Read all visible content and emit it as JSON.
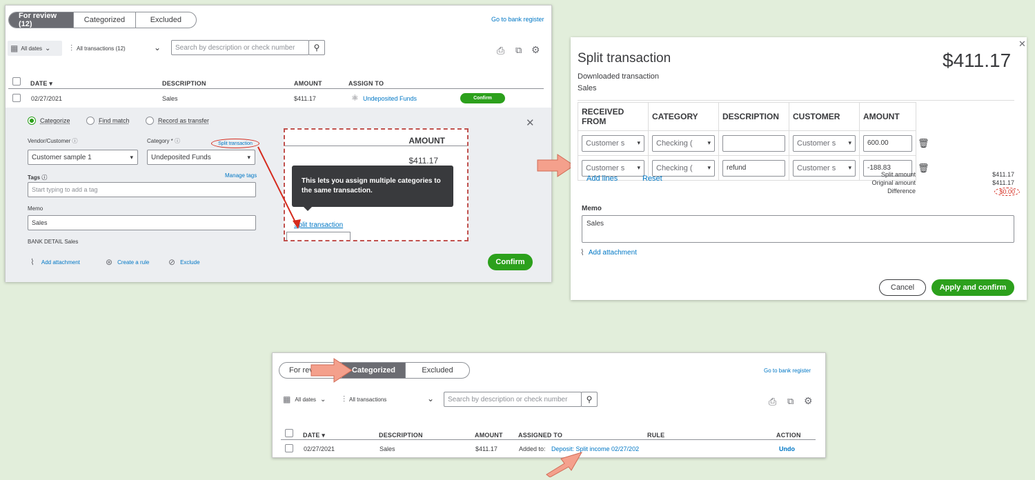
{
  "panel1": {
    "tabs": [
      "For review (12)",
      "Categorized",
      "Excluded"
    ],
    "bank_register": "Go to bank register",
    "dates": "All dates",
    "transactions": "All transactions (12)",
    "search_placeholder": "Search by description or check number",
    "headers": {
      "date": "DATE",
      "description": "DESCRIPTION",
      "amount": "AMOUNT",
      "assign": "ASSIGN TO"
    },
    "row": {
      "date": "02/27/2021",
      "description": "Sales",
      "amount": "$411.17",
      "assign": "Undeposited Funds",
      "confirm": "Confirm"
    },
    "radios": [
      "Categorize",
      "Find match",
      "Record as transfer"
    ],
    "vendor_label": "Vendor/Customer",
    "vendor_value": "Customer sample 1",
    "category_label": "Category *",
    "category_value": "Undeposited Funds",
    "split_link": "Split transaction",
    "tags_label": "Tags",
    "manage_tags": "Manage tags",
    "tags_placeholder": "Start typing to add a tag",
    "memo_label": "Memo",
    "memo_value": "Sales",
    "bank_detail": "BANK DETAIL Sales",
    "add_attachment": "Add attachment",
    "create_rule": "Create a rule",
    "exclude": "Exclude",
    "confirm_big": "Confirm",
    "zoom": {
      "amount_header": "AMOUNT",
      "amount_value": "$411.17",
      "tooltip": "This lets you assign multiple categories to the same transaction.",
      "split_link": "Split transaction"
    }
  },
  "panel2": {
    "title": "Split transaction",
    "total": "$411.17",
    "downloaded": "Downloaded transaction",
    "sub": "Sales",
    "headers": [
      "RECEIVED FROM",
      "CATEGORY",
      "DESCRIPTION",
      "CUSTOMER",
      "AMOUNT"
    ],
    "rows": [
      {
        "from": "Customer s",
        "category": "Checking (",
        "description": "",
        "customer": "Customer s",
        "amount": "600.00"
      },
      {
        "from": "Customer s",
        "category": "Checking (",
        "description": "refund",
        "customer": "Customer s",
        "amount": "-188.83"
      }
    ],
    "add_lines": "Add lines",
    "reset": "Reset",
    "summary": [
      {
        "label": "Split amount",
        "value": "$411.17"
      },
      {
        "label": "Original amount",
        "value": "$411.17"
      },
      {
        "label": "Difference",
        "value": "$0.00"
      }
    ],
    "memo_label": "Memo",
    "memo_value": "Sales",
    "add_attachment": "Add attachment",
    "cancel": "Cancel",
    "apply": "Apply and confirm"
  },
  "panel3": {
    "tabs": [
      "For revi",
      "Categorized",
      "Excluded"
    ],
    "bank_register": "Go to bank register",
    "dates": "All dates",
    "transactions": "All transactions",
    "search_placeholder": "Search by description or check number",
    "headers": {
      "date": "DATE",
      "description": "DESCRIPTION",
      "amount": "AMOUNT",
      "assigned": "ASSIGNED TO",
      "rule": "RULE",
      "action": "ACTION"
    },
    "row": {
      "date": "02/27/2021",
      "description": "Sales",
      "amount": "$411.17",
      "added_to": "Added to:",
      "link": "Deposit: Split income 02/27/202",
      "undo": "Undo"
    }
  },
  "colors": {
    "green": "#2ca01c",
    "link": "#0077c5",
    "arrow": "#f4a08c",
    "red": "#d52b1e"
  }
}
